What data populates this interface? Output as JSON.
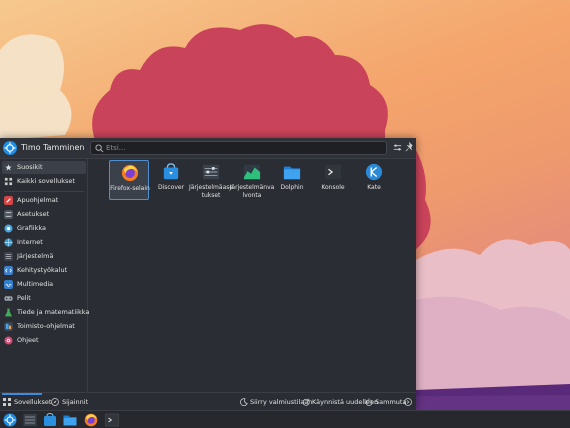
{
  "header": {
    "username": "Timo Tamminen",
    "search_placeholder": "Etsi..."
  },
  "sidebar": {
    "items": [
      {
        "label": "Suosikit",
        "icon": "star-icon",
        "active": true
      },
      {
        "label": "Kaikki sovellukset",
        "icon": "grid-icon"
      },
      {
        "label": "Apuohjelmat",
        "icon": "utilities-icon"
      },
      {
        "label": "Asetukset",
        "icon": "settings-icon"
      },
      {
        "label": "Grafiikka",
        "icon": "graphics-icon"
      },
      {
        "label": "Internet",
        "icon": "globe-icon"
      },
      {
        "label": "Järjestelmä",
        "icon": "system-icon"
      },
      {
        "label": "Kehitystyökalut",
        "icon": "development-icon"
      },
      {
        "label": "Multimedia",
        "icon": "multimedia-icon"
      },
      {
        "label": "Pelit",
        "icon": "games-icon"
      },
      {
        "label": "Tiede ja matematiikka",
        "icon": "science-icon"
      },
      {
        "label": "Toimisto-ohjelmat",
        "icon": "office-icon"
      },
      {
        "label": "Ohjeet",
        "icon": "help-icon"
      }
    ]
  },
  "favorites": [
    {
      "label": "Firefox-selain",
      "icon": "firefox-icon",
      "selected": true
    },
    {
      "label": "Discover",
      "icon": "discover-icon"
    },
    {
      "label": "Järjestelmäase tukset",
      "icon": "system-settings-icon"
    },
    {
      "label": "Järjestelmänva lvonta",
      "icon": "system-monitor-icon"
    },
    {
      "label": "Dolphin",
      "icon": "dolphin-icon"
    },
    {
      "label": "Konsole",
      "icon": "konsole-icon"
    },
    {
      "label": "Kate",
      "icon": "kate-icon"
    }
  ],
  "bottom": {
    "tabs": [
      {
        "label": "Sovellukset",
        "active": true
      },
      {
        "label": "Sijainnit"
      }
    ],
    "actions": {
      "sleep": "Siirry valmiustilaan",
      "restart": "Käynnistä uudelleen",
      "shutdown": "Sammuta"
    }
  },
  "colors": {
    "accent": "#3d8be0",
    "panel_bg": "#2a2d33"
  }
}
